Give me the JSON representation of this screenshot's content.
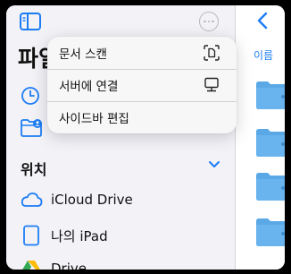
{
  "sidebar": {
    "title": "파일",
    "section_title": "위치",
    "locations": [
      {
        "label": "iCloud Drive",
        "icon": "icloud-icon"
      },
      {
        "label": "나의 iPad",
        "icon": "ipad-icon"
      },
      {
        "label": "Drive",
        "icon": "google-drive-icon"
      }
    ]
  },
  "menu": {
    "items": [
      {
        "label": "문서 스캔",
        "icon": "scan-document-icon"
      },
      {
        "label": "서버에 연결",
        "icon": "connect-server-icon"
      },
      {
        "label": "사이드바 편집",
        "icon": null
      }
    ]
  },
  "browser": {
    "sort_label": "이름"
  },
  "colors": {
    "accent": "#1c7cf4",
    "folder": "#5aa9e6"
  }
}
